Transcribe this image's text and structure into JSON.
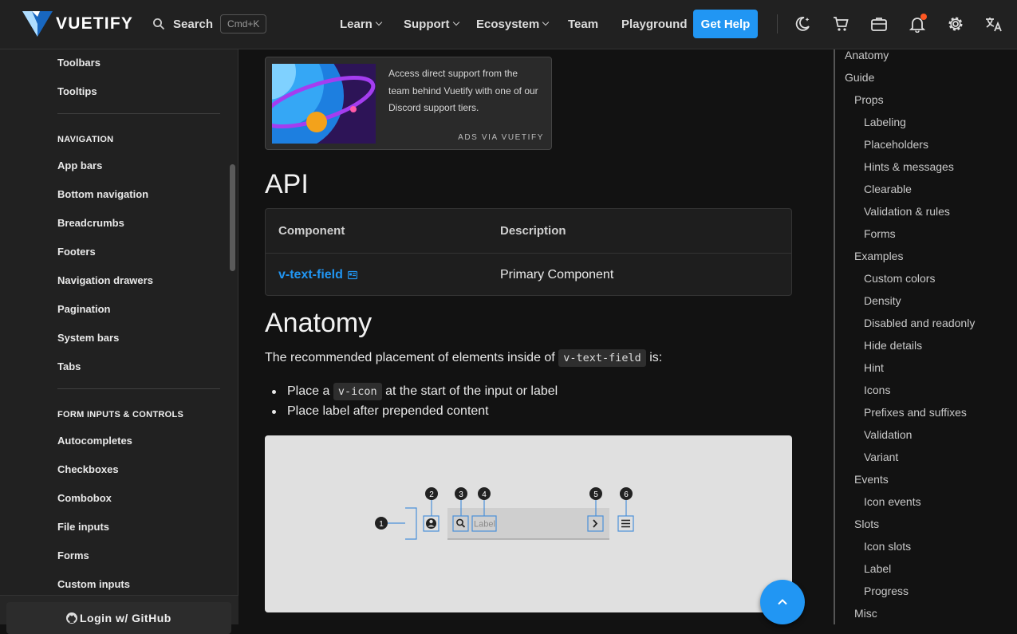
{
  "header": {
    "logo_text": "VUETIFY",
    "search_label": "Search",
    "search_shortcut": "Cmd+K",
    "nav": [
      {
        "label": "Learn"
      },
      {
        "label": "Support"
      },
      {
        "label": "Ecosystem"
      },
      {
        "label": "Team"
      },
      {
        "label": "Playground"
      }
    ],
    "cta_label": "Get Help",
    "accent": "#2196f3"
  },
  "sidebar": {
    "top_items": [
      "Toolbars",
      "Tooltips"
    ],
    "navigation_heading": "NAVIGATION",
    "navigation_items": [
      "App bars",
      "Bottom navigation",
      "Breadcrumbs",
      "Footers",
      "Navigation drawers",
      "Pagination",
      "System bars",
      "Tabs"
    ],
    "forms_heading": "FORM INPUTS & CONTROLS",
    "forms_items": [
      "Autocompletes",
      "Checkboxes",
      "Combobox",
      "File inputs",
      "Forms",
      "Custom inputs"
    ],
    "login_label": "Login w/ GitHub"
  },
  "ad": {
    "text": "Access direct support from the team behind Vuetify with one of our Discord support tiers.",
    "footer": "ADS VIA VUETIFY"
  },
  "api": {
    "title": "API",
    "col_component": "Component",
    "col_description": "Description",
    "row_component": "v-text-field",
    "row_description": "Primary Component"
  },
  "anatomy": {
    "title": "Anatomy",
    "intro_before": "The recommended placement of elements inside of",
    "intro_code": "v-text-field",
    "intro_after": "is:",
    "bullet1_before": "Place a",
    "bullet1_code": "v-icon",
    "bullet1_after": "at the start of the input or label",
    "bullet2": "Place label after prepended content",
    "diagram_label": "Label",
    "markers": [
      "1",
      "2",
      "3",
      "4",
      "5",
      "6"
    ]
  },
  "toc": {
    "items": [
      {
        "label": "Anatomy",
        "level": 0
      },
      {
        "label": "Guide",
        "level": 0
      },
      {
        "label": "Props",
        "level": 1
      },
      {
        "label": "Labeling",
        "level": 2
      },
      {
        "label": "Placeholders",
        "level": 2
      },
      {
        "label": "Hints & messages",
        "level": 2
      },
      {
        "label": "Clearable",
        "level": 2
      },
      {
        "label": "Validation & rules",
        "level": 2
      },
      {
        "label": "Forms",
        "level": 2
      },
      {
        "label": "Examples",
        "level": 1
      },
      {
        "label": "Custom colors",
        "level": 2
      },
      {
        "label": "Density",
        "level": 2
      },
      {
        "label": "Disabled and readonly",
        "level": 2
      },
      {
        "label": "Hide details",
        "level": 2
      },
      {
        "label": "Hint",
        "level": 2
      },
      {
        "label": "Icons",
        "level": 2
      },
      {
        "label": "Prefixes and suffixes",
        "level": 2
      },
      {
        "label": "Validation",
        "level": 2
      },
      {
        "label": "Variant",
        "level": 2
      },
      {
        "label": "Events",
        "level": 1
      },
      {
        "label": "Icon events",
        "level": 2
      },
      {
        "label": "Slots",
        "level": 1
      },
      {
        "label": "Icon slots",
        "level": 2
      },
      {
        "label": "Label",
        "level": 2
      },
      {
        "label": "Progress",
        "level": 2
      },
      {
        "label": "Misc",
        "level": 1
      }
    ]
  }
}
